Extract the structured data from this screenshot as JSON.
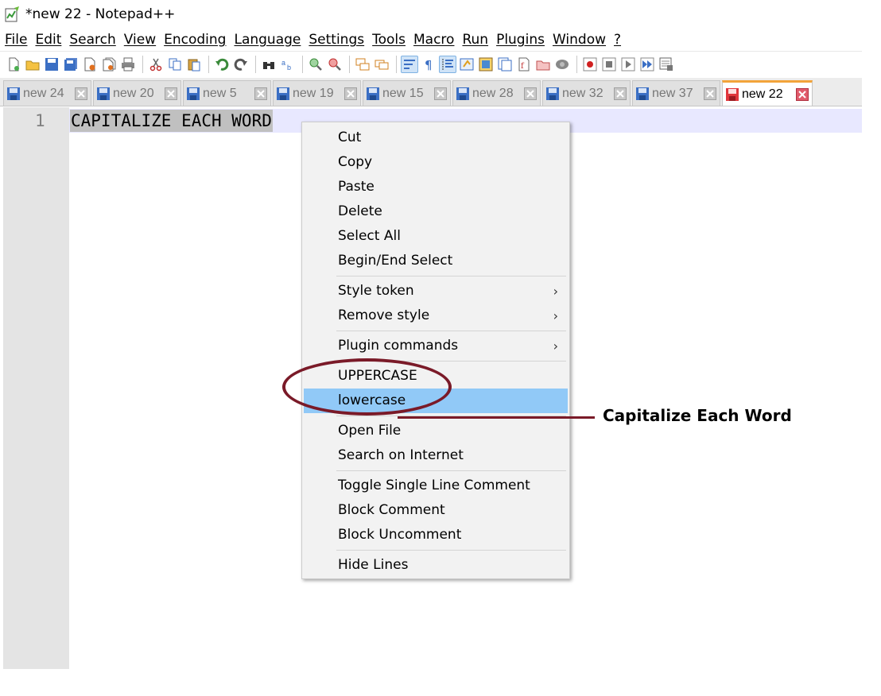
{
  "window": {
    "title": "*new 22 - Notepad++"
  },
  "menubar": {
    "items": [
      "File",
      "Edit",
      "Search",
      "View",
      "Encoding",
      "Language",
      "Settings",
      "Tools",
      "Macro",
      "Run",
      "Plugins",
      "Window",
      "?"
    ]
  },
  "tabs": [
    {
      "label": "new 24"
    },
    {
      "label": "new 20"
    },
    {
      "label": "new 5"
    },
    {
      "label": "new 19"
    },
    {
      "label": "new 15"
    },
    {
      "label": "new 28"
    },
    {
      "label": "new 32"
    },
    {
      "label": "new 37"
    },
    {
      "label": "new 22",
      "active": true
    }
  ],
  "editor": {
    "line_number": "1",
    "text": "CAPITALIZE EACH WORD"
  },
  "context_menu": {
    "items": [
      "Cut",
      "Copy",
      "Paste",
      "Delete",
      "Select All",
      "Begin/End Select",
      "Style token",
      "Remove style",
      "Plugin commands",
      "UPPERCASE",
      "lowercase",
      "Open File",
      "Search on Internet",
      "Toggle Single Line Comment",
      "Block Comment",
      "Block Uncomment",
      "Hide Lines"
    ],
    "submenu_arrow": "›"
  },
  "annotation": {
    "label": "Capitalize Each Word",
    "color": "#7a1a28"
  },
  "colors": {
    "highlight": "#91c9f7",
    "gutter": "#e4e4e4",
    "current_line": "#e8e8ff",
    "active_tab_accent": "#f2a43a"
  }
}
